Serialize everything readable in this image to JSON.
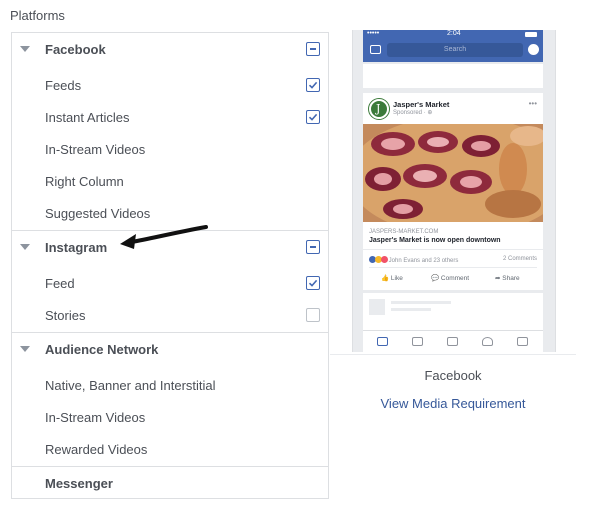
{
  "heading": "Platforms",
  "groups": {
    "facebook": {
      "label": "Facebook",
      "items": [
        {
          "label": "Feeds",
          "checked": true
        },
        {
          "label": "Instant Articles",
          "checked": true
        },
        {
          "label": "In-Stream Videos",
          "checked": false
        },
        {
          "label": "Right Column",
          "checked": false
        },
        {
          "label": "Suggested Videos",
          "checked": false
        }
      ]
    },
    "instagram": {
      "label": "Instagram",
      "items": [
        {
          "label": "Feed",
          "checked": true
        },
        {
          "label": "Stories",
          "checked": false
        }
      ]
    },
    "audience_network": {
      "label": "Audience Network",
      "items": [
        {
          "label": "Native, Banner and Interstitial"
        },
        {
          "label": "In-Stream Videos"
        },
        {
          "label": "Rewarded Videos"
        }
      ]
    },
    "messenger": {
      "label": "Messenger"
    }
  },
  "preview": {
    "status_time": "2:04",
    "status_signal": "•••••",
    "search_placeholder": "Search",
    "page_name": "Jasper's Market",
    "sponsored": "Sponsored · ⊕",
    "domain": "JASPERS-MARKET.COM",
    "headline": "Jasper's Market is now open downtown",
    "reactions": "John Evans and 23 others",
    "comments": "2 Comments",
    "actions": [
      "Like",
      "Comment",
      "Share"
    ],
    "placement_name": "Facebook",
    "link": "View Media Requirement"
  },
  "colors": {
    "accent": "#4267b2",
    "link": "#365899",
    "text": "#4b4f56",
    "border": "#dddfe2"
  }
}
